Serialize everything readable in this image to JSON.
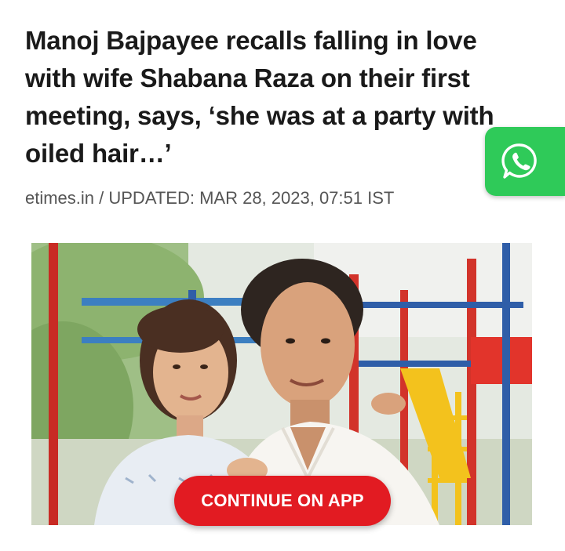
{
  "article": {
    "headline_lines": [
      "Manoj Bajpayee recalls falling in love",
      "with wife Shabana Raza on their first",
      "meeting, says, ‘she was at a party with",
      "oiled hair…’"
    ],
    "byline": "etimes.in / UPDATED: MAR 28, 2023, 07:51 IST"
  },
  "share": {
    "icon": "whatsapp-icon",
    "color": "#2fca59"
  },
  "cta": {
    "label": "CONTINUE ON APP",
    "color": "#e21b22"
  }
}
